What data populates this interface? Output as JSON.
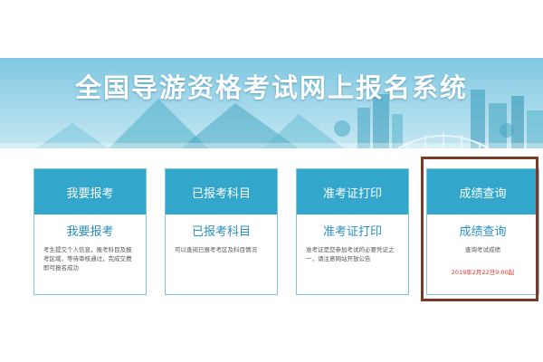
{
  "banner": {
    "title": "全国导游资格考试网上报名系统"
  },
  "cards": [
    {
      "header": "我要报考",
      "title": "我要报考",
      "desc": "考生提交个人信息，报考科目及报考区域，等待审核通过，完成交费即可报名成功"
    },
    {
      "header": "已报考科目",
      "title": "已报考科目",
      "desc": "可以查阅已报考考区及科目情况"
    },
    {
      "header": "准考证打印",
      "title": "准考证打印",
      "desc": "准考证是您参加考试的必要凭证之一，请注意网站开放公告"
    },
    {
      "header": "成绩查询",
      "title": "成绩查询",
      "desc": "查询考试成绩",
      "date": "2019年2月22日9:00起"
    }
  ],
  "colors": {
    "accent": "#33a6cc",
    "highlight_border": "#7a3a28",
    "date_red": "#d9342b"
  }
}
